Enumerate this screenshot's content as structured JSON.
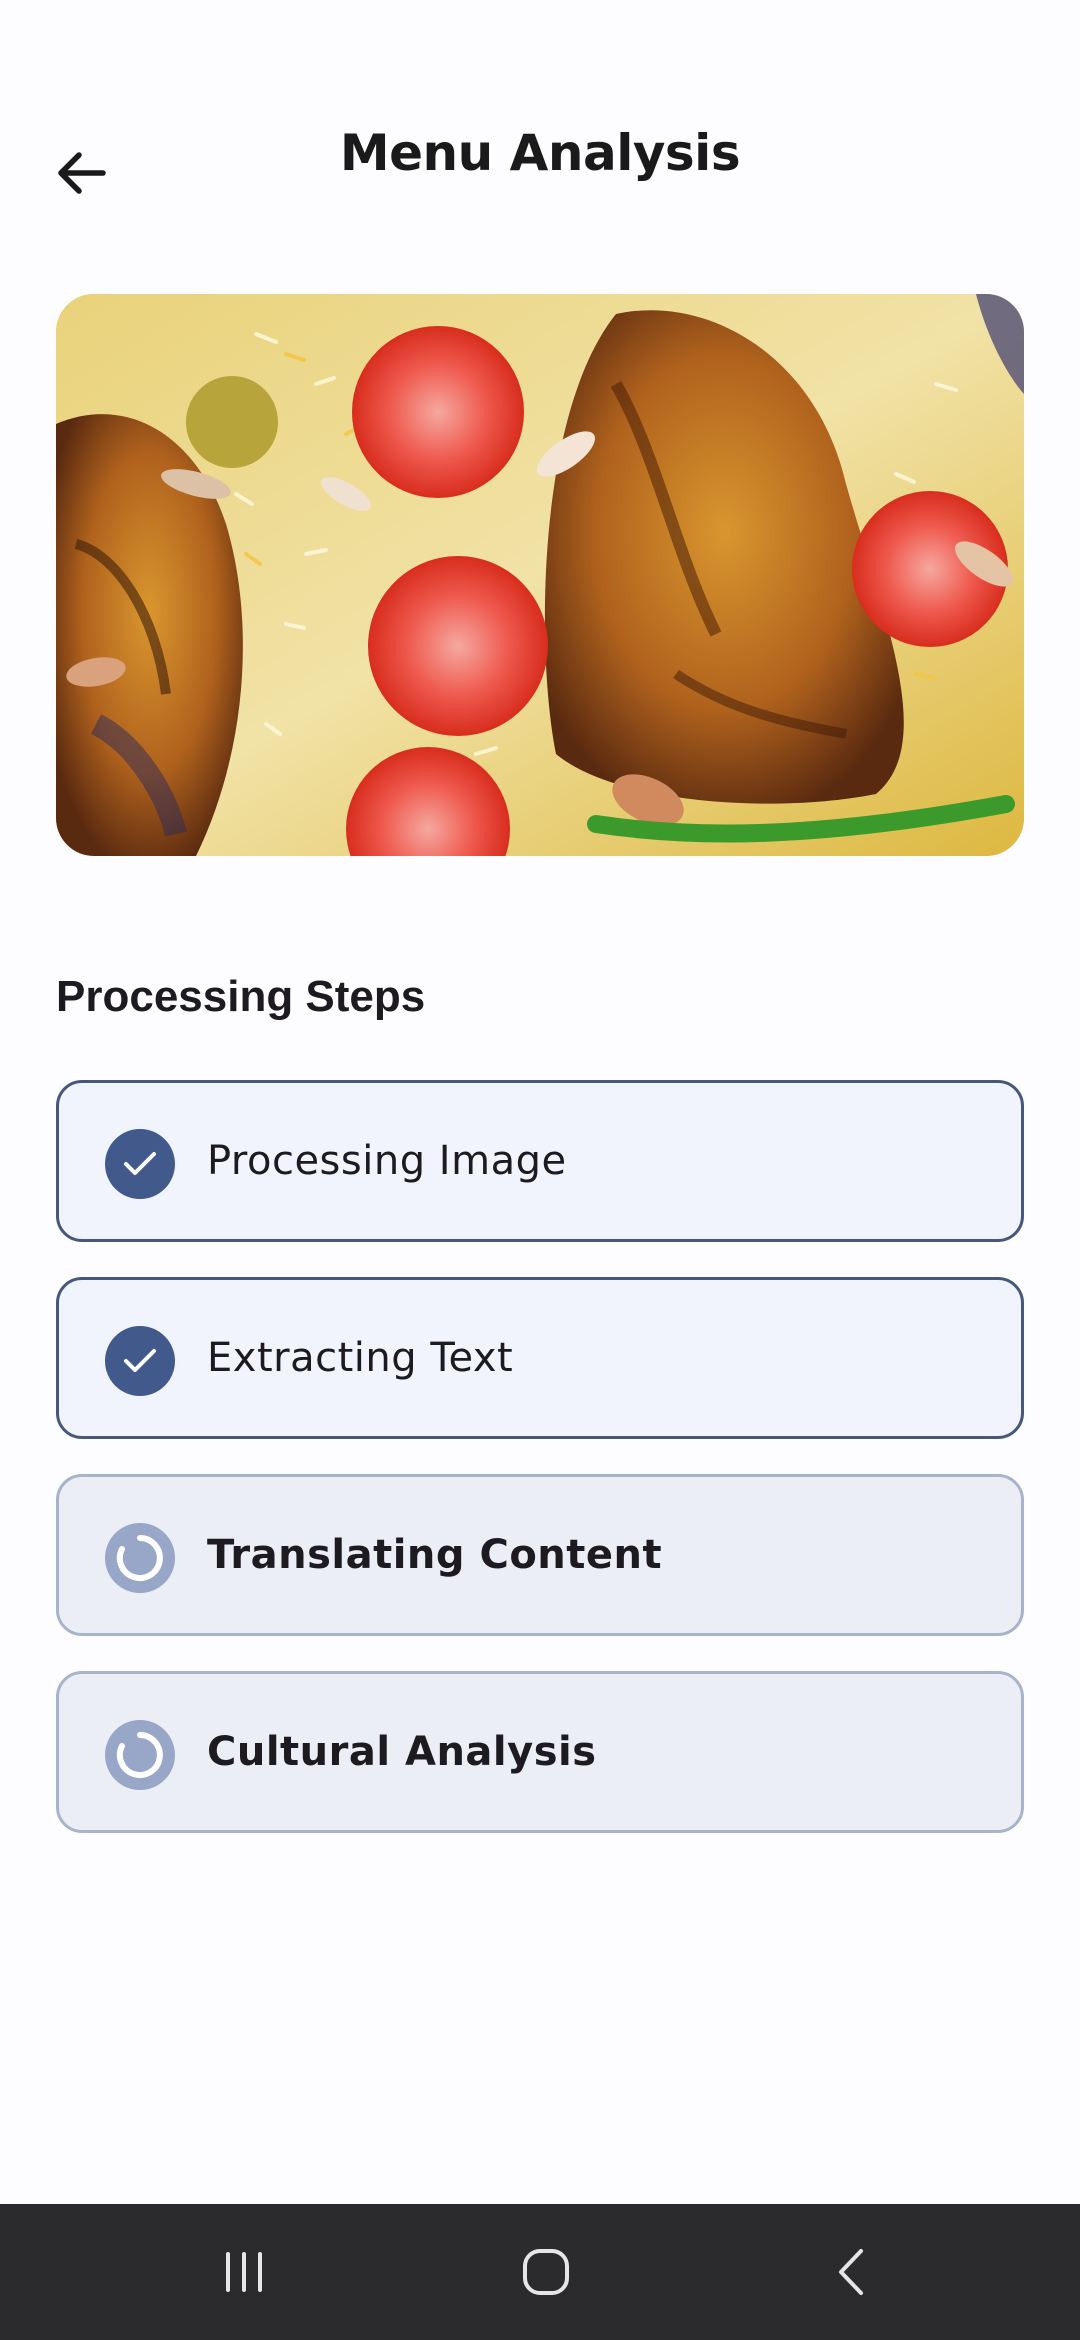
{
  "header": {
    "title": "Menu Analysis",
    "back_icon": "arrow-left-icon"
  },
  "hero": {
    "icon": "food-photo"
  },
  "processing": {
    "section_title": "Processing Steps",
    "steps": [
      {
        "label": "Processing Image",
        "status": "done",
        "icon": "check-icon"
      },
      {
        "label": "Extracting Text",
        "status": "done",
        "icon": "check-icon"
      },
      {
        "label": "Translating Content",
        "status": "pending",
        "icon": "spinner-icon"
      },
      {
        "label": "Cultural Analysis",
        "status": "pending",
        "icon": "spinner-icon"
      }
    ]
  },
  "navbar": {
    "recents_icon": "recents-icon",
    "home_icon": "home-icon",
    "back_icon": "back-chevron-icon"
  },
  "colors": {
    "done_bg": "#f1f4fd",
    "done_border": "#48587a",
    "done_icon": "#425a8b",
    "pending_bg": "#ebeef4",
    "pending_border": "#a9b3cb",
    "pending_icon": "#98a6c8",
    "navbar_bg": "#2b2b2d"
  }
}
